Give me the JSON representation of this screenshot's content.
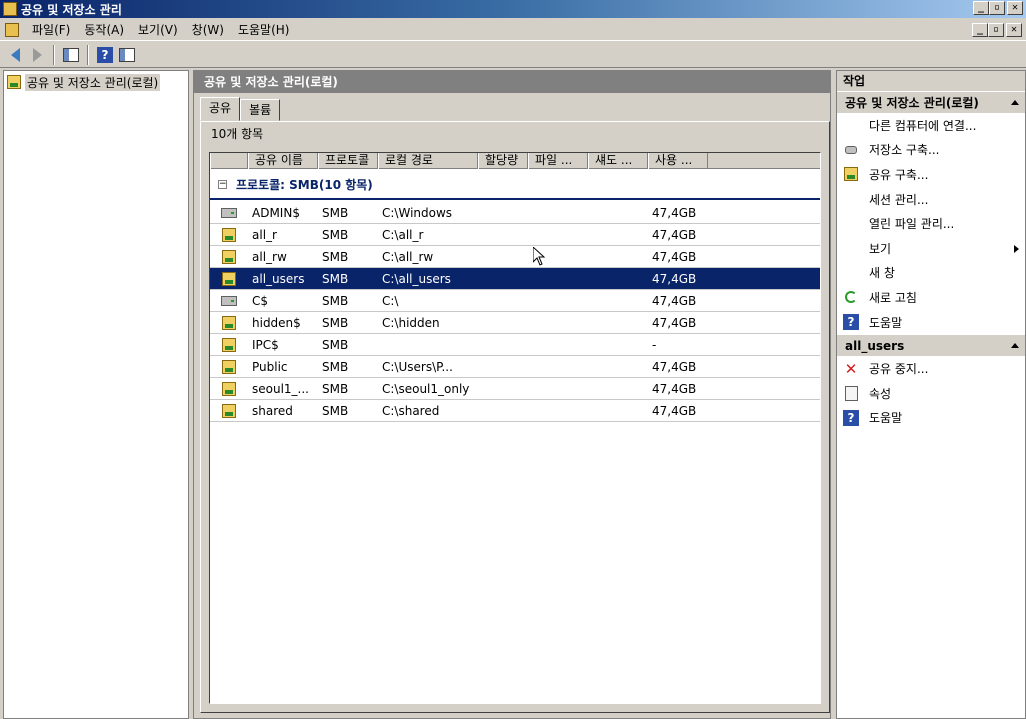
{
  "window": {
    "title": "공유 및 저장소 관리",
    "min_glyph": "_",
    "restore_glyph": "▫",
    "close_glyph": "✕"
  },
  "menu": {
    "items": [
      "파일(F)",
      "동작(A)",
      "보기(V)",
      "창(W)",
      "도움말(H)"
    ]
  },
  "toolbar": {
    "help_glyph": "?"
  },
  "tree": {
    "root_label": "공유 및 저장소 관리(로컬)"
  },
  "center": {
    "header": "공유 및 저장소 관리(로컬)",
    "tabs": [
      "공유",
      "볼륨"
    ],
    "item_count": "10개 항목",
    "columns": [
      "공유 이름",
      "프로토콜",
      "로컬 경로",
      "할당량",
      "파일 ...",
      "섀도 ...",
      "사용 ..."
    ],
    "group_label": "프로토콜: SMB(10 항목)",
    "group_toggle": "−",
    "rows": [
      {
        "name": "ADMIN$",
        "protocol": "SMB",
        "path": "C:\\Windows",
        "used": "47,4GB",
        "icon": "admin-share-icon"
      },
      {
        "name": "all_r",
        "protocol": "SMB",
        "path": "C:\\all_r",
        "used": "47,4GB",
        "icon": "share-icon"
      },
      {
        "name": "all_rw",
        "protocol": "SMB",
        "path": "C:\\all_rw",
        "used": "47,4GB",
        "icon": "share-icon"
      },
      {
        "name": "all_users",
        "protocol": "SMB",
        "path": "C:\\all_users",
        "used": "47,4GB",
        "icon": "share-icon",
        "selected": true
      },
      {
        "name": "C$",
        "protocol": "SMB",
        "path": "C:\\",
        "used": "47,4GB",
        "icon": "admin-share-icon"
      },
      {
        "name": "hidden$",
        "protocol": "SMB",
        "path": "C:\\hidden",
        "used": "47,4GB",
        "icon": "share-icon"
      },
      {
        "name": "IPC$",
        "protocol": "SMB",
        "path": "",
        "used": "-",
        "icon": "share-icon"
      },
      {
        "name": "Public",
        "protocol": "SMB",
        "path": "C:\\Users\\P...",
        "used": "47,4GB",
        "icon": "share-icon"
      },
      {
        "name": "seoul1_...",
        "protocol": "SMB",
        "path": "C:\\seoul1_only",
        "used": "47,4GB",
        "icon": "share-icon"
      },
      {
        "name": "shared",
        "protocol": "SMB",
        "path": "C:\\shared",
        "used": "47,4GB",
        "icon": "share-icon"
      }
    ]
  },
  "actions": {
    "title": "작업",
    "section1": {
      "label": "공유 및 저장소 관리(로컬)",
      "items": [
        {
          "label": "다른 컴퓨터에 연결...",
          "icon": "none"
        },
        {
          "label": "저장소 구축...",
          "icon": "drive-icon"
        },
        {
          "label": "공유 구축...",
          "icon": "share-icon"
        },
        {
          "label": "세션 관리...",
          "icon": "none"
        },
        {
          "label": "열린 파일 관리...",
          "icon": "none"
        },
        {
          "label": "보기",
          "icon": "none",
          "submenu": true
        },
        {
          "label": "새 창",
          "icon": "none"
        },
        {
          "label": "새로 고침",
          "icon": "refresh-icon"
        },
        {
          "label": "도움말",
          "icon": "help-icon"
        }
      ]
    },
    "section2": {
      "label": "all_users",
      "items": [
        {
          "label": "공유 중지...",
          "icon": "stop-icon"
        },
        {
          "label": "속성",
          "icon": "properties-icon"
        },
        {
          "label": "도움말",
          "icon": "help-icon"
        }
      ]
    },
    "help_glyph": "?",
    "stop_glyph": "✕"
  },
  "colors": {
    "selection": "#0a246a",
    "titlebar_start": "#0a246a",
    "titlebar_end": "#a6caf0",
    "face": "#d4d0c8"
  }
}
